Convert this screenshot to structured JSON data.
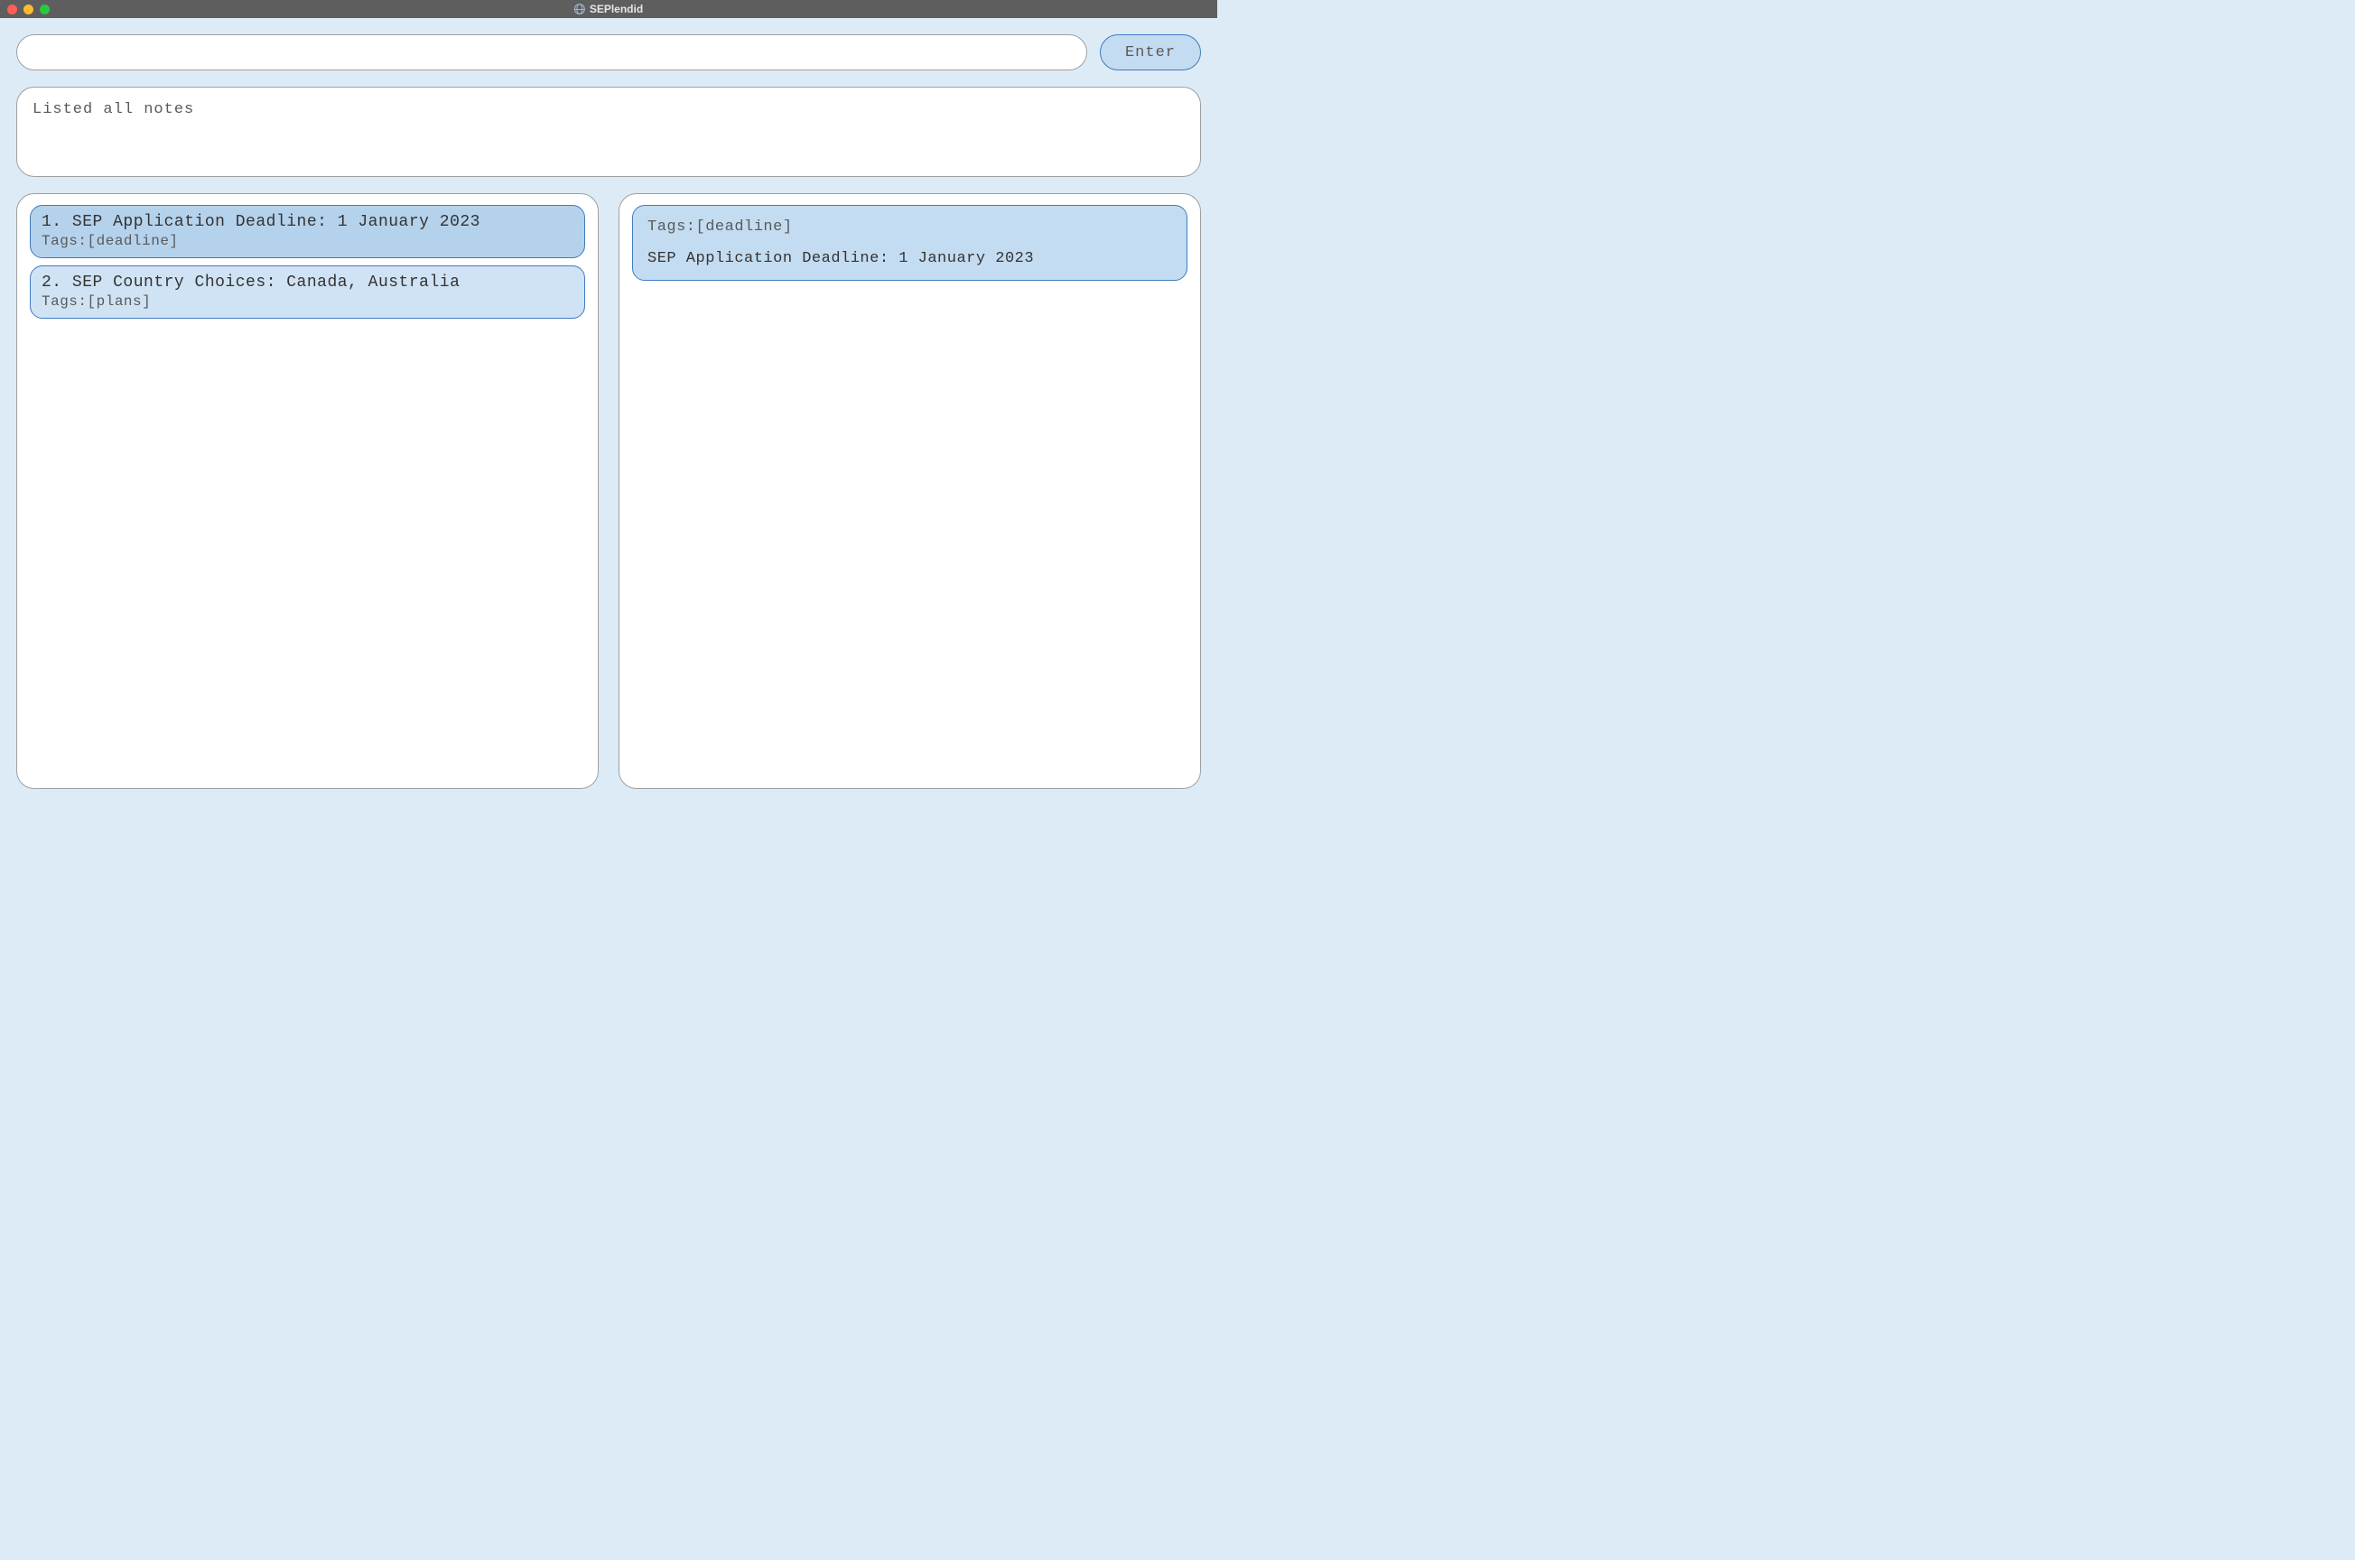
{
  "window": {
    "title": "SEPlendid"
  },
  "command": {
    "value": "",
    "placeholder": "",
    "enter_label": "Enter"
  },
  "result": {
    "message": "Listed all notes"
  },
  "notes": [
    {
      "index": "1.",
      "title": "SEP Application Deadline: 1 January 2023",
      "tags": "Tags:[deadline]",
      "selected": true
    },
    {
      "index": "2.",
      "title": "SEP Country Choices: Canada, Australia",
      "tags": "Tags:[plans]",
      "selected": false
    }
  ],
  "detail": {
    "tags": "Tags:[deadline]",
    "body": "SEP Application Deadline: 1 January 2023"
  }
}
